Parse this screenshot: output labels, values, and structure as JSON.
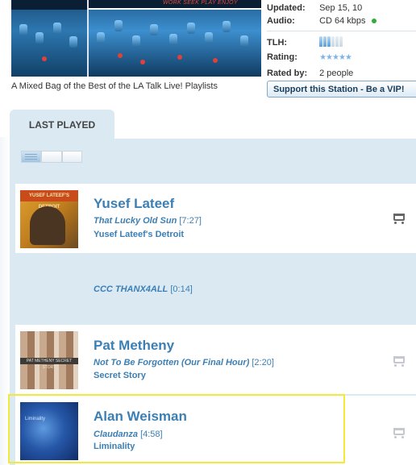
{
  "station": {
    "banner_tagline": "WORK SEEK PLAY ENJOY",
    "caption": "A Mixed Bag of the Best of the LA Talk Live! Playlists",
    "meta": {
      "updated_label": "Updated:",
      "updated_value": "Sep 15, 10",
      "audio_label": "Audio:",
      "audio_value": "CD 64 kbps",
      "tlh_label": "TLH:",
      "rating_label": "Rating:",
      "rating_stars": "★★★★★",
      "rated_by_label": "Rated by:",
      "rated_by_value": "2 people"
    },
    "vip_button": "Support this Station - Be a VIP!"
  },
  "last_played": {
    "tab_label": "LAST PLAYED",
    "tracks": [
      {
        "artist": "Yusef Lateef",
        "title": "That Lucky Old Sun",
        "duration": "[7:27]",
        "album": "Yusef Lateef's Detroit",
        "cover_text": "YUSEF LATEEF'S DETROIT"
      },
      {
        "artist": "",
        "title": "CCC THANX4ALL",
        "duration": "[0:14]",
        "album": ""
      },
      {
        "artist": "Pat Metheny",
        "title": "Not To Be Forgotten (Our Final Hour)",
        "duration": "[2:20]",
        "album": "Secret Story",
        "cover_text": "PAT METHENY SECRET STORY"
      },
      {
        "artist": "Alan Weisman",
        "title": "Claudanza",
        "duration": "[4:58]",
        "album": "Liminality",
        "cover_text": "Liminality"
      }
    ]
  },
  "colors": {
    "accent": "#3b7fb5",
    "panel": "#dbe9f3",
    "highlight": "#f2ea3a",
    "online": "#2fae3a"
  },
  "icons": [
    "cart-icon",
    "tlh-meter-icon",
    "rating-stars-icon",
    "list-view-icon",
    "grid-view-icon"
  ]
}
